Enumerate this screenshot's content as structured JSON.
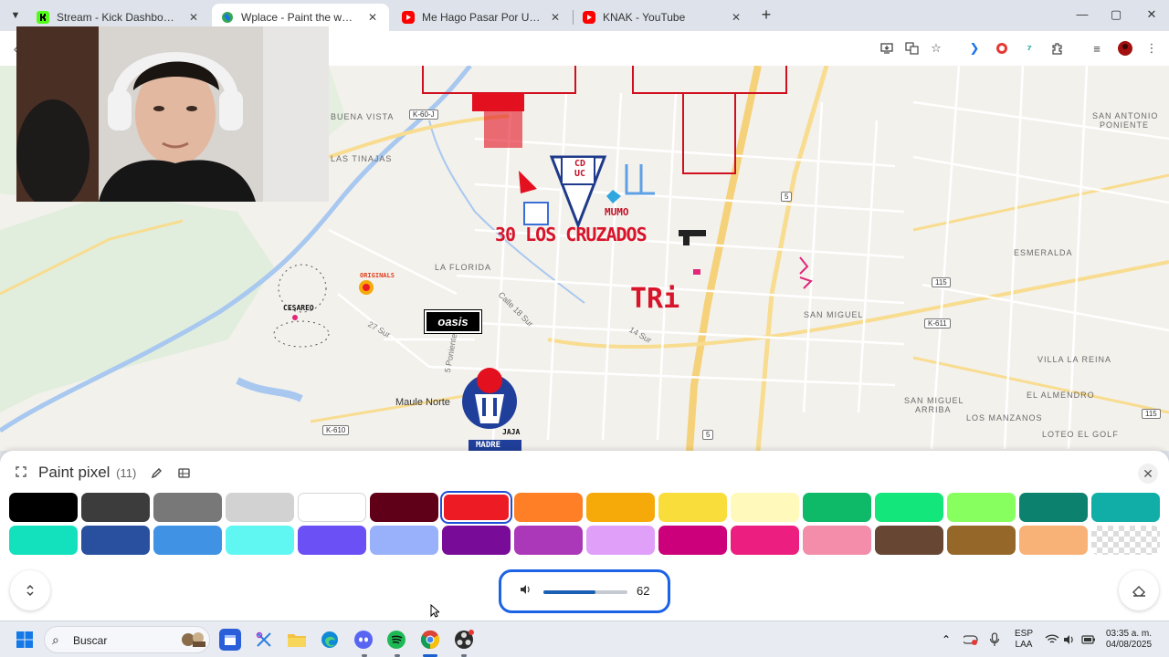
{
  "tabs": [
    {
      "title": "Stream - Kick Dashboard",
      "favicon": "kick-icon",
      "color": "#53fc18"
    },
    {
      "title": "Wplace - Paint the world",
      "favicon": "globe-icon",
      "color": "#1a73e8",
      "active": true
    },
    {
      "title": "Me Hago Pasar Por Una Figura",
      "favicon": "youtube-icon",
      "color": "#ff0000"
    },
    {
      "title": "KNAK - YouTube",
      "favicon": "youtube-icon",
      "color": "#ff0000"
    }
  ],
  "window": {
    "new_tab": "+",
    "minimize": "—",
    "maximize": "▢",
    "close": "✕"
  },
  "map": {
    "places": [
      "SAN ANTONIO",
      "PONIENTE",
      "BUENA VISTA",
      "LAS TINAJAS",
      "LA FLORIDA",
      "ESMERALDA",
      "SAN MIGUEL",
      "VILLA LA REINA",
      "EL ALMENDRO",
      "SAN MIGUEL",
      "ARRIBA",
      "LOS MANZANOS",
      "LOTEO EL GOLF"
    ],
    "town": "Maule Norte",
    "roads": [
      "K-60-J",
      "5",
      "115",
      "K-611",
      "K-610",
      "5",
      "115"
    ],
    "streets": [
      "Calle 18 Sur",
      "27 Sur",
      "5 Poniente",
      "14 Sur"
    ],
    "art_labels": {
      "cruzados": "30 LOS CRUZADOS",
      "tri": "TRi",
      "oasis": "oasis",
      "mumo": "MUMO",
      "cdu": "CD UC",
      "originals": "ORIGINALS",
      "cesareo": "CESAREO",
      "jaja": "JAJA",
      "madre": "MADRE"
    }
  },
  "panel": {
    "title": "Paint pixel",
    "count": "(11)",
    "colors": [
      "#000000",
      "#3c3c3c",
      "#787878",
      "#d2d2d2",
      "#ffffff",
      "#600018",
      "#ed1c24",
      "#ff7f27",
      "#f6aa09",
      "#f9dd3b",
      "#fffabc",
      "#0eb968",
      "#13e67b",
      "#87ff5e",
      "#0c816e",
      "#10aea6",
      "#13e1be",
      "#28509e",
      "#4093e4",
      "#60f7f2",
      "#6b50f6",
      "#99b1fb",
      "#780c99",
      "#aa38b9",
      "#e09ff9",
      "#cb007a",
      "#ec1f80",
      "#f38da9",
      "#684634",
      "#95682a",
      "#f8b277",
      "transparent"
    ],
    "selected_index": 6
  },
  "volume": {
    "value": "62",
    "level": 0.62
  },
  "taskbar": {
    "search_placeholder": "Buscar"
  },
  "tray": {
    "lang": "ESP",
    "region": "LAA",
    "time": "03:35 a. m.",
    "date": "04/08/2025"
  }
}
